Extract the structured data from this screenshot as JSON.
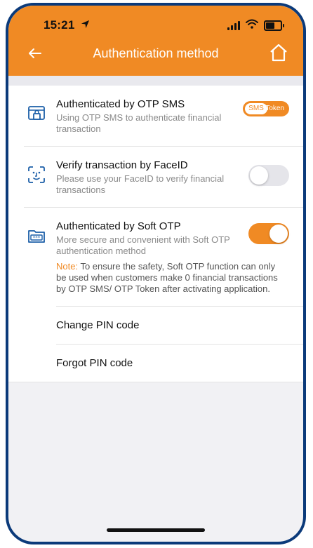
{
  "status": {
    "time": "15:21"
  },
  "nav": {
    "title": "Authentication method"
  },
  "items": [
    {
      "title": "Authenticated by OTP SMS",
      "description": "Using OTP SMS to authenticate financial transaction",
      "control": {
        "type": "segmented",
        "options": [
          "SMS",
          "Token"
        ],
        "selected": "SMS"
      }
    },
    {
      "title": "Verify transaction by FaceID",
      "description": " Please use your FaceID to verify financial transactions",
      "control": {
        "type": "toggle",
        "on": false
      }
    },
    {
      "title": "Authenticated by Soft OTP",
      "description": "More secure and convenient with Soft OTP authentication method",
      "note_label": "Note:",
      "note_text": " To ensure the safety, Soft OTP function can only be used when customers make 0 financial transactions by OTP SMS/ OTP Token after activating application.",
      "control": {
        "type": "toggle",
        "on": true
      }
    }
  ],
  "links": {
    "change_pin": "Change PIN code",
    "forgot_pin": "Forgot PIN code"
  },
  "colors": {
    "accent": "#f08a24",
    "frame": "#0b3a7a",
    "background": "#f1f1f4"
  },
  "icons": [
    "location-arrow-icon",
    "signal-icon",
    "wifi-icon",
    "battery-icon",
    "back-arrow-icon",
    "home-icon",
    "sms-lock-icon",
    "faceid-icon",
    "otp-folder-icon"
  ]
}
